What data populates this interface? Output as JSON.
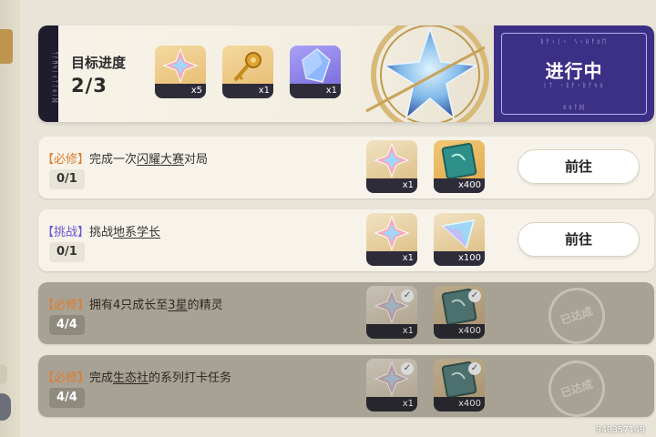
{
  "header": {
    "side_runes": "ᛏᚨᛗᛋᛁᚾᛏᛚᛟᛁᛞ",
    "title": "目标进度",
    "progress": "2/3",
    "rewards": [
      {
        "icon": "star-crystal-icon",
        "count": "x5"
      },
      {
        "icon": "golden-key-icon",
        "count": "x1"
      },
      {
        "icon": "blue-crystal-icon",
        "count": "x1"
      }
    ],
    "status": {
      "label": "进行中",
      "runes_top": "ᚱᚨᚲᛁᚲ ᛊᚲᚺᚨᛟᛖ",
      "runes_mid": "ᛁᛏ ᚲᚱᚨᚲᚱᚨᛋᛟ",
      "runes_bottom": "ᛟᛟᚨᛞ"
    }
  },
  "tasks": [
    {
      "tag": "【必修】",
      "tag_type": "required",
      "text_before": "完成一次",
      "text_highlight": "闪耀大赛",
      "text_after": "对局",
      "progress": "0/1",
      "done": false,
      "button": "前往",
      "rewards": [
        {
          "icon": "star-crystal-icon",
          "count": "x1"
        },
        {
          "icon": "green-ticket-icon",
          "count": "x400"
        }
      ]
    },
    {
      "tag": "【挑战】",
      "tag_type": "challenge",
      "text_before": "挑战",
      "text_highlight": "地系学长",
      "text_after": "",
      "progress": "0/1",
      "done": false,
      "button": "前往",
      "rewards": [
        {
          "icon": "star-crystal-icon",
          "count": "x1"
        },
        {
          "icon": "prism-crystal-icon",
          "count": "x100"
        }
      ]
    },
    {
      "tag": "【必修】",
      "tag_type": "required",
      "text_before": "拥有4只成长至",
      "text_highlight": "3星",
      "text_after": "的精灵",
      "progress": "4/4",
      "done": true,
      "stamp": "已达成",
      "rewards": [
        {
          "icon": "star-crystal-icon",
          "count": "x1"
        },
        {
          "icon": "green-ticket-icon",
          "count": "x400"
        }
      ]
    },
    {
      "tag": "【必修】",
      "tag_type": "required",
      "text_before": "完成",
      "text_highlight": "生态社",
      "text_after": "的系列打卡任务",
      "progress": "4/4",
      "done": true,
      "stamp": "已达成",
      "rewards": [
        {
          "icon": "star-crystal-icon",
          "count": "x1"
        },
        {
          "icon": "green-ticket-icon",
          "count": "x400"
        }
      ]
    }
  ],
  "uid": "940357149",
  "colors": {
    "required_tag": "#e07b2a",
    "challenge_tag": "#6a53d6",
    "status_bg": "#3b2f86"
  }
}
